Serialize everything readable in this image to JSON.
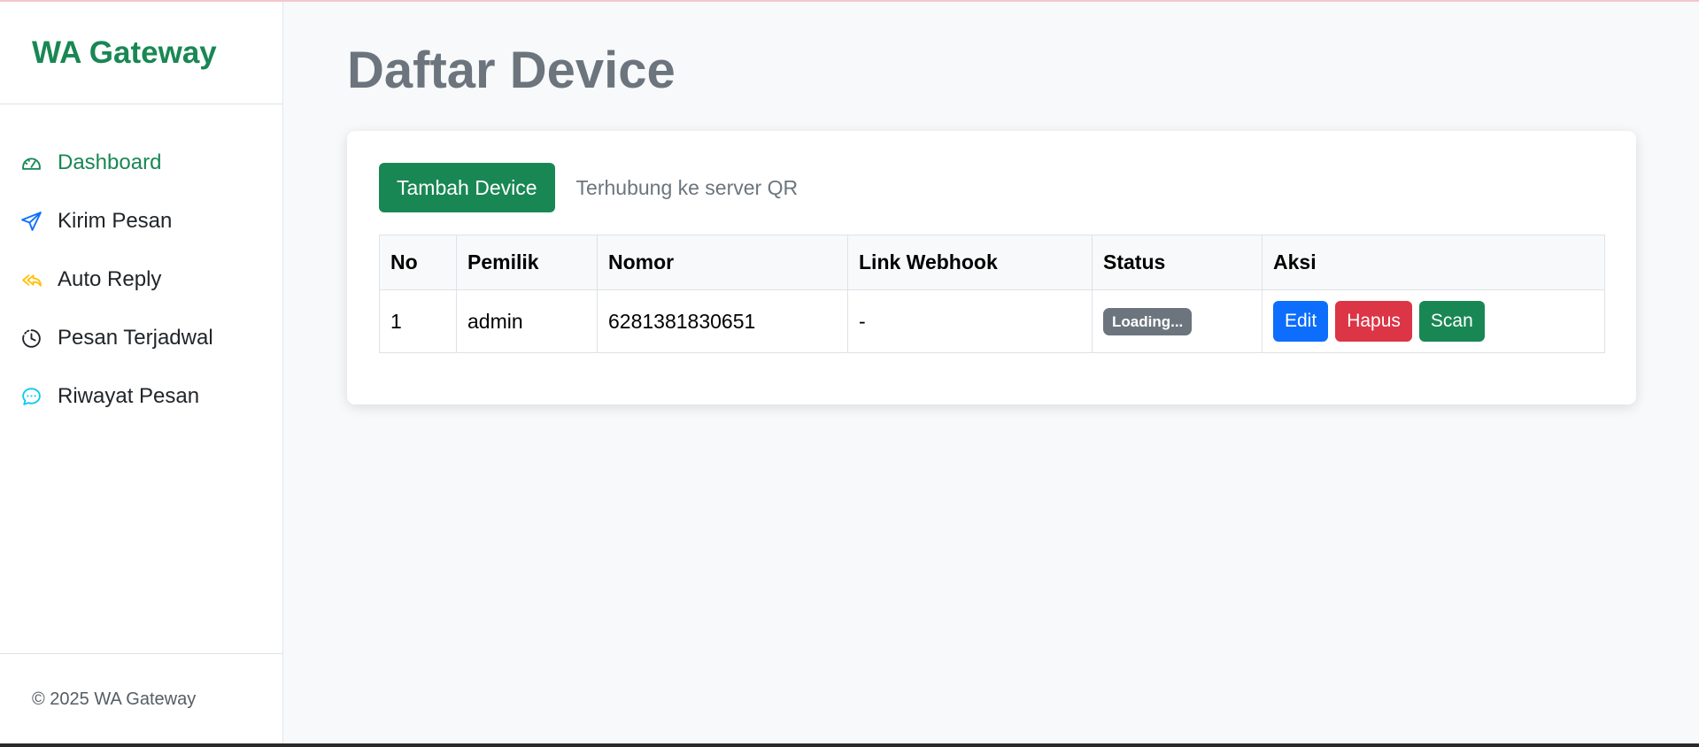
{
  "sidebar": {
    "brand": "WA Gateway",
    "items": [
      {
        "label": "Dashboard",
        "icon": "speedometer-icon",
        "active": true
      },
      {
        "label": "Kirim Pesan",
        "icon": "send-icon",
        "active": false
      },
      {
        "label": "Auto Reply",
        "icon": "reply-all-icon",
        "active": false
      },
      {
        "label": "Pesan Terjadwal",
        "icon": "clock-icon",
        "active": false
      },
      {
        "label": "Riwayat Pesan",
        "icon": "chat-dots-icon",
        "active": false
      }
    ],
    "footer": "© 2025 WA Gateway"
  },
  "main": {
    "title": "Daftar Device",
    "add_button": "Tambah Device",
    "connection_status": "Terhubung ke server QR",
    "table": {
      "headers": [
        "No",
        "Pemilik",
        "Nomor",
        "Link Webhook",
        "Status",
        "Aksi"
      ],
      "rows": [
        {
          "no": "1",
          "owner": "admin",
          "number": "6281381830651",
          "webhook": "-",
          "status": "Loading...",
          "actions": {
            "edit": "Edit",
            "delete": "Hapus",
            "scan": "Scan"
          }
        }
      ]
    }
  },
  "colors": {
    "brand": "#198754",
    "primary": "#0d6efd",
    "danger": "#dc3545",
    "secondary": "#6c757d",
    "icon_send": "#0d6efd",
    "icon_reply": "#ffc107",
    "icon_chat": "#0dcaf0"
  }
}
